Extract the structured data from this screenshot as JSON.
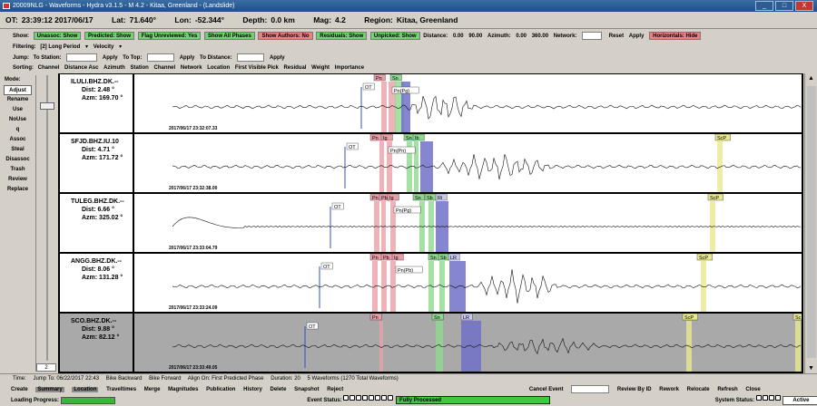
{
  "window": {
    "title": "20009NLG - Waveforms - Hydra v3.1.5 - M 4.2 - Kitaa, Greenland - (Landslide)",
    "buttons": [
      "_",
      "□",
      "X"
    ]
  },
  "event": {
    "ot_label": "OT:",
    "ot_value": "23:39:12 2017/06/17",
    "lat_label": "Lat:",
    "lat_value": "71.640°",
    "lon_label": "Lon:",
    "lon_value": "-52.344°",
    "depth_label": "Depth:",
    "depth_value": "0.0 km",
    "mag_label": "Mag:",
    "mag_value": "4.2",
    "region_label": "Region:",
    "region_value": "Kitaa, Greenland"
  },
  "show": {
    "label": "Show:",
    "unassoc": "Unassoc: Show",
    "predicted": "Predicted: Show",
    "flag_unreviewed": "Flag Unreviewed: Yes",
    "show_all_phases": "Show All Phases",
    "show_authors": "Show Authors: No",
    "residuals": "Residuals: Show",
    "unpicked": "Unpicked: Show",
    "distance_label": "Distance:",
    "distance_min": "0.00",
    "distance_max": "90.00",
    "azimuth_label": "Azimuth:",
    "azimuth_min": "0.00",
    "azimuth_max": "360.00",
    "network_label": "Network:",
    "reset": "Reset",
    "apply": "Apply",
    "horizontals": "Horizontals: Hide"
  },
  "filtering": {
    "label": "Filtering:",
    "filter": "[2] Long Period",
    "velocity": "Velocity"
  },
  "jump": {
    "label": "Jump:",
    "to_station": "To Station:",
    "apply1": "Apply",
    "to_top": "To Top:",
    "apply2": "Apply",
    "to_distance": "To Distance:",
    "apply3": "Apply"
  },
  "sorting": {
    "label": "Sorting:",
    "options": [
      "Channel",
      "Distance Asc",
      "Azimuth",
      "Station",
      "Channel",
      "Network",
      "Location",
      "First Visible Pick",
      "Residual",
      "Weight",
      "Importance"
    ]
  },
  "mode": {
    "label": "Mode:",
    "items": [
      "Adjust",
      "Rename",
      "Use",
      "NoUse",
      "q",
      "Assoc",
      "Steal",
      "Disassoc",
      "Trash",
      "Review",
      "Replace"
    ],
    "active": "Adjust"
  },
  "page_number": "2",
  "traces": [
    {
      "station": "ILULI.BHZ.DK.--",
      "dist": "Dist: 2.48 °",
      "azm": "Azm: 169.70 °",
      "datetime": "2017/06/17 23:32:07.33",
      "gray": false,
      "labels": [
        "OT",
        "Pn",
        "Sn",
        "Pn(Pg)"
      ]
    },
    {
      "station": "SFJD.BHZ.IU.10",
      "dist": "Dist: 4.71 °",
      "azm": "Azm: 171.72 °",
      "datetime": "2017/06/17 23:32:38.00",
      "gray": false,
      "labels": [
        "OT",
        "Pn",
        "Ig",
        "Sn",
        "Ib",
        "Pn(Pn)",
        "ScP"
      ]
    },
    {
      "station": "TULEG.BHZ.DK.--",
      "dist": "Dist: 6.66 °",
      "azm": "Azm: 325.02 °",
      "datetime": "2017/06/17 23:33:04.79",
      "gray": false,
      "labels": [
        "OT",
        "Pn",
        "Pb",
        "Ig",
        "Sn",
        "Sb",
        "Ri",
        "Pn(Pg)",
        "ScP"
      ]
    },
    {
      "station": "ANGG.BHZ.DK.--",
      "dist": "Dist: 8.06 °",
      "azm": "Azm: 131.28 °",
      "datetime": "2017/06/17 23:33:24.09",
      "gray": false,
      "labels": [
        "OT",
        "Pn",
        "Pb",
        "Ig",
        "Sn",
        "Sb",
        "LR",
        "Pn(Pb)",
        "ScP"
      ]
    },
    {
      "station": "SCO.BHZ.DK.--",
      "dist": "Dist: 9.88 °",
      "azm": "Azm: 82.12 °",
      "datetime": "2017/06/17 23:33:49.05",
      "gray": true,
      "labels": [
        "OT",
        "Pn",
        "Sn",
        "LR",
        "ScP",
        "Sc"
      ]
    }
  ],
  "timebar": {
    "time_label": "Time:",
    "jump_to": "Jump To: 06/22/2017  22:43",
    "bike_backward": "Bike Backward",
    "bike_forward": "Bike Forward",
    "align_on": "Align On: First Predicted Phase",
    "duration": "Duration: 20",
    "waveforms": "5 Waveforms (1270 Total Waveforms)"
  },
  "menu": {
    "items": [
      "Create",
      "Summary",
      "Location",
      "Traveltimes",
      "Merge",
      "Magnitudes",
      "Publication",
      "History",
      "Delete",
      "Snapshot",
      "Reject"
    ],
    "selected": [
      "Summary",
      "Location"
    ],
    "right_items": [
      "Cancel Event",
      "Review By ID",
      "Rework",
      "Relocate",
      "Refresh",
      "Close"
    ]
  },
  "status": {
    "loading_label": "Loading Progress:",
    "event_status_label": "Event Status:",
    "event_status_value": "Fully Processed",
    "system_status_label": "System Status:",
    "system_status_value": "Active"
  },
  "colors": {
    "unassoc_green": "#6fd36f",
    "authors_red": "#f08080",
    "pn_pink": "#e8a0a8",
    "sn_green": "#8fd88f",
    "lr_blue": "#7070c8",
    "scp_yellow": "#e8e890",
    "ot_blue": "#3050c0"
  }
}
